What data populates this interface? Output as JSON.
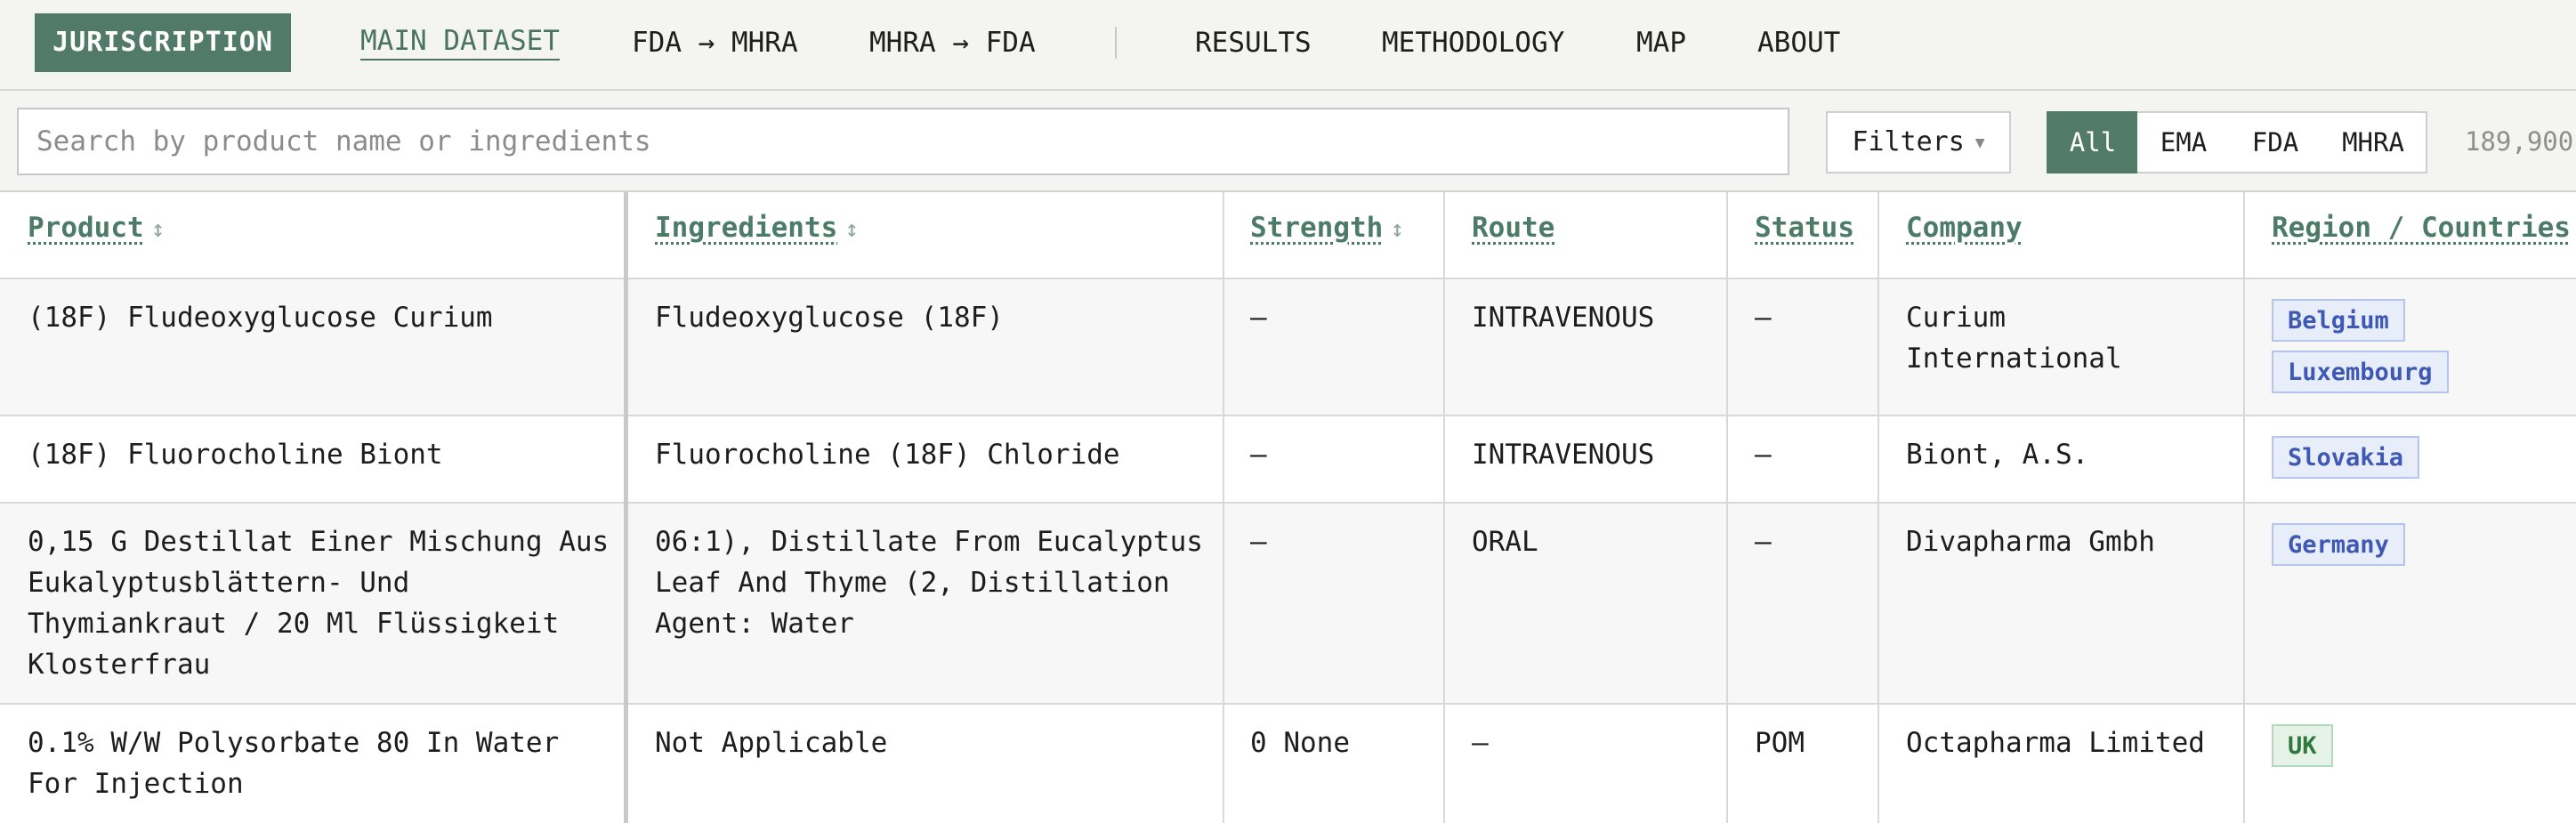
{
  "nav": {
    "brand": "JURISCRIPTION",
    "links": [
      "MAIN DATASET",
      "FDA → MHRA",
      "MHRA → FDA",
      "RESULTS",
      "METHODOLOGY",
      "MAP",
      "ABOUT"
    ]
  },
  "search": {
    "placeholder": "Search by product name or ingredients",
    "value": "",
    "filters_label": "Filters",
    "segments": [
      "All",
      "EMA",
      "FDA",
      "MHRA"
    ],
    "selected_segment": "All",
    "count": "189,900"
  },
  "table": {
    "columns": [
      "Product",
      "Ingredients",
      "Strength",
      "Route",
      "Status",
      "Company",
      "Region / Countries"
    ],
    "sort_glyph": "↕",
    "rows": [
      {
        "product": "(18F) Fludeoxyglucose Curium",
        "ingredients": "Fludeoxyglucose (18F)",
        "strength": "—",
        "route": "INTRAVENOUS",
        "status": "—",
        "company": "Curium\nInternational",
        "regions": [
          "Belgium",
          "Luxembourg"
        ],
        "region_type": "eu"
      },
      {
        "product": "(18F) Fluorocholine Biont",
        "ingredients": "Fluorocholine (18F) Chloride",
        "strength": "—",
        "route": "INTRAVENOUS",
        "status": "—",
        "company": "Biont, A.S.",
        "regions": [
          "Slovakia"
        ],
        "region_type": "eu"
      },
      {
        "product": "0,15 G Destillat Einer Mischung Aus\nEukalyptusblättern- Und\nThymiankraut / 20 Ml Flüssigkeit\nKlosterfrau",
        "ingredients": "06:1), Distillate From Eucalyptus\nLeaf And Thyme (2, Distillation\nAgent: Water",
        "strength": "—",
        "route": "ORAL",
        "status": "—",
        "company": "Divapharma Gmbh",
        "regions": [
          "Germany"
        ],
        "region_type": "eu"
      },
      {
        "product": "0.1% W/W Polysorbate 80 In Water\nFor Injection",
        "ingredients": "Not Applicable",
        "strength": "0 None",
        "route": "—",
        "status": "POM",
        "company": "Octapharma Limited",
        "regions": [
          "UK"
        ],
        "region_type": "uk"
      }
    ]
  }
}
